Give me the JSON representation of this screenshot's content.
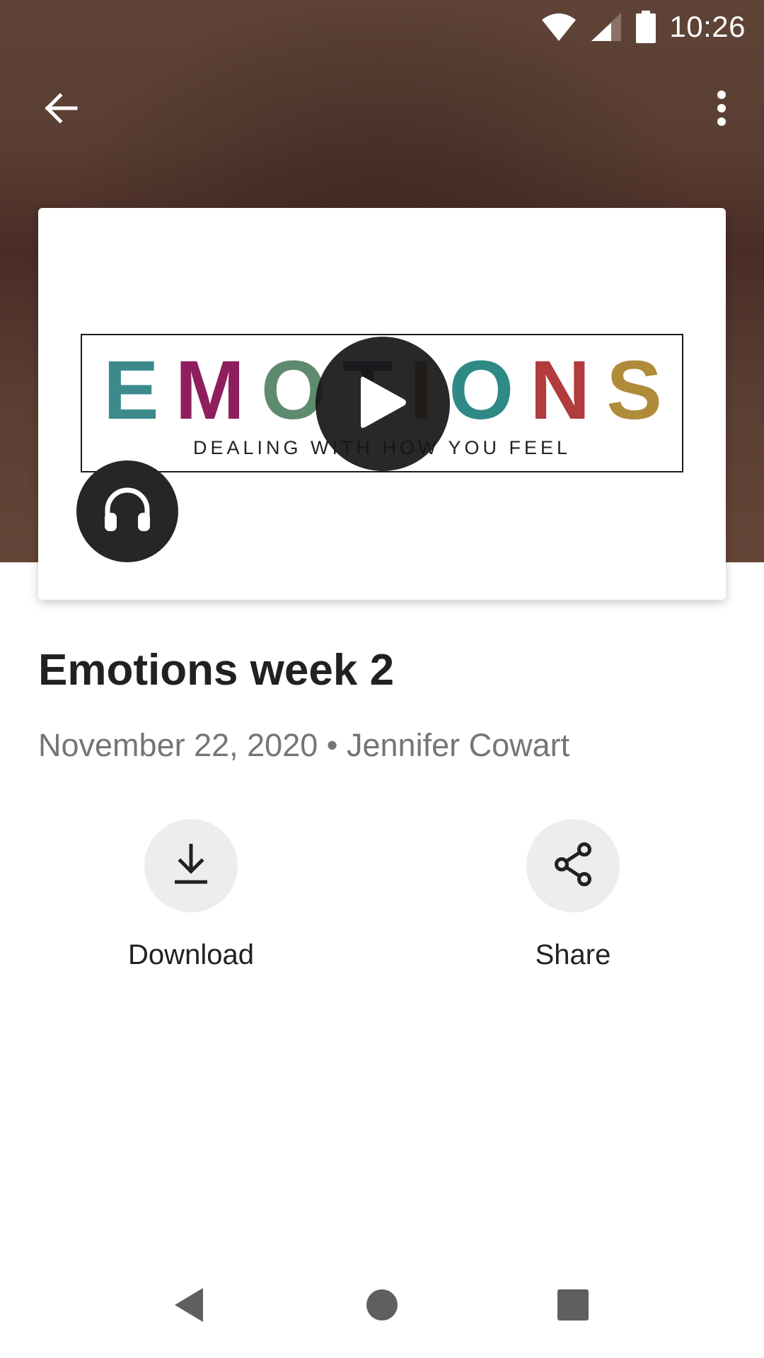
{
  "status_bar": {
    "time": "10:26",
    "icons": [
      "wifi-icon",
      "cell-signal-icon",
      "battery-icon"
    ]
  },
  "app_bar": {
    "back_icon": "arrow-back-icon",
    "menu_icon": "more-vert-icon"
  },
  "media": {
    "banner_letters": [
      "E",
      "M",
      "O",
      "T",
      "I",
      "O",
      "N",
      "S"
    ],
    "banner_subtitle": "DEALING WITH HOW YOU FEEL",
    "play_icon": "play-icon",
    "audio_icon": "headphones-icon"
  },
  "episode": {
    "title": "Emotions week 2",
    "meta": "November 22, 2020 • Jennifer Cowart"
  },
  "actions": [
    {
      "label": "Download",
      "icon": "download-icon"
    },
    {
      "label": "Share",
      "icon": "share-icon"
    }
  ],
  "nav_bar": {
    "icons": [
      "nav-back-icon",
      "nav-home-icon",
      "nav-recents-icon"
    ]
  },
  "colors": {
    "header_brown": "#5a3e33",
    "text_primary": "#212121",
    "text_secondary": "#757575",
    "action_circle": "#ededed"
  }
}
